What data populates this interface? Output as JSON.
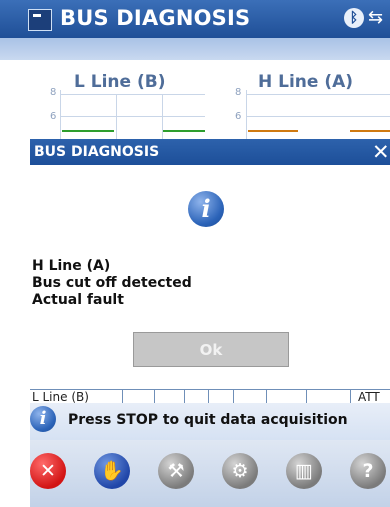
{
  "app": {
    "title": "BUS DIAGNOSIS",
    "status_icons": [
      "bluetooth-icon",
      "connection-icon"
    ]
  },
  "charts": {
    "left": {
      "label": "L Line (B)",
      "ticks": [
        "8",
        "6"
      ],
      "color": "#2e9e2e"
    },
    "right": {
      "label": "H Line (A)",
      "ticks": [
        "8",
        "6"
      ],
      "color": "#d07a10"
    }
  },
  "dialog": {
    "title": "BUS DIAGNOSIS",
    "close_glyph": "✕",
    "icon": "info-icon",
    "lines": [
      "H Line (A)",
      "Bus cut off detected",
      "Actual fault"
    ],
    "ok_label": "Ok"
  },
  "status_row": {
    "left_text": "L Line (B)",
    "right_text": "ATT"
  },
  "hint": {
    "text": "Press STOP to quit data acquisition"
  },
  "toolbar": {
    "buttons": [
      {
        "icon": "stop-icon",
        "enabled": true
      },
      {
        "icon": "hand-icon",
        "enabled": true
      },
      {
        "icon": "wrench-icon",
        "enabled": false
      },
      {
        "icon": "settings-icon",
        "enabled": false
      },
      {
        "icon": "trash-icon",
        "enabled": false
      },
      {
        "icon": "help-icon",
        "enabled": false
      }
    ]
  }
}
